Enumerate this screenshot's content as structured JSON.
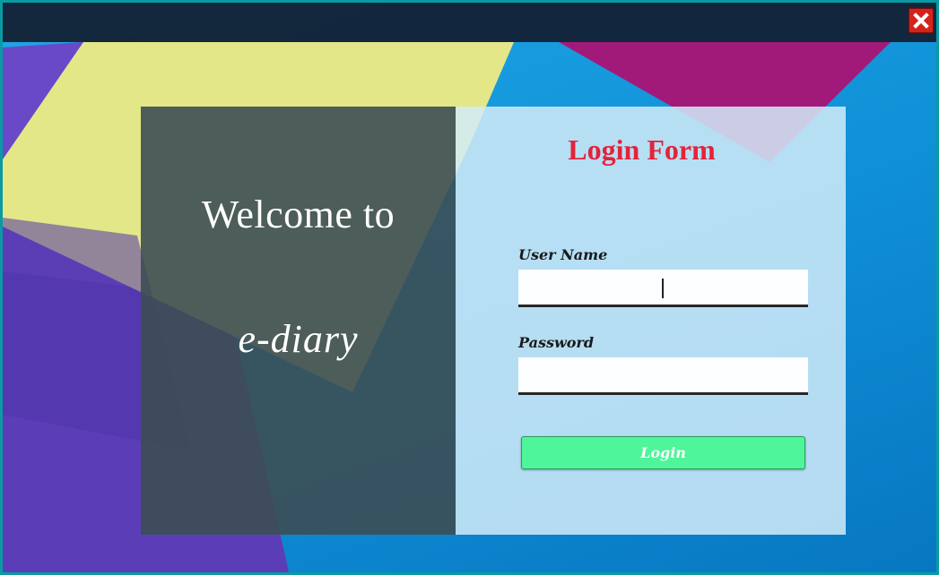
{
  "window": {
    "close_icon": "close-x-icon",
    "accent_color": "#d3241c"
  },
  "welcome_panel": {
    "heading": "Welcome to",
    "brand": "e-diary"
  },
  "login_form": {
    "title": "Login Form",
    "title_color": "#e3233a",
    "username_label": "User Name",
    "username_value": "",
    "password_label": "Password",
    "password_value": "",
    "login_button": "Login",
    "button_color": "#4ff59a"
  }
}
